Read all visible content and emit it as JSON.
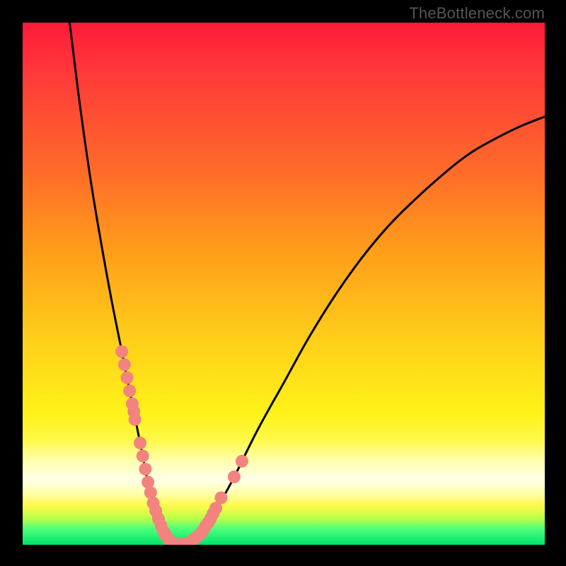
{
  "watermark": "TheBottleneck.com",
  "chart_data": {
    "type": "line",
    "title": "",
    "xlabel": "",
    "ylabel": "",
    "xlim": [
      0,
      100
    ],
    "ylim": [
      0,
      100
    ],
    "grid": false,
    "legend": null,
    "series": [
      {
        "name": "bottleneck-curve",
        "x": [
          9,
          11,
          13,
          15,
          17,
          19,
          20,
          21,
          22,
          23,
          24,
          25,
          26,
          27,
          28,
          29,
          30,
          32,
          34,
          36,
          40,
          45,
          50,
          55,
          60,
          65,
          70,
          75,
          80,
          85,
          90,
          95,
          100
        ],
        "y": [
          100,
          84,
          70,
          58,
          47,
          37,
          32,
          27,
          22,
          17,
          12,
          8,
          5,
          2.5,
          1,
          0.2,
          0,
          0.5,
          2,
          5,
          12,
          22,
          31,
          40,
          48,
          55,
          61,
          66,
          70.5,
          74.5,
          77.5,
          80,
          82
        ]
      }
    ],
    "highlight_points": {
      "name": "threshold-dots",
      "color": "#f2837f",
      "x": [
        19.0,
        19.5,
        20.0,
        20.5,
        21.0,
        21.3,
        21.5,
        22.5,
        23.0,
        23.5,
        24.0,
        24.5,
        25.0,
        25.5,
        26.0,
        26.5,
        27.0,
        27.5,
        28.0,
        28.5,
        29.0,
        29.5,
        30.0,
        30.5,
        31.5,
        32.5,
        33.0,
        33.5,
        34.0,
        34.5,
        35.0,
        35.5,
        36.0,
        36.5,
        37.0,
        38.0,
        40.5,
        42.0
      ],
      "y": [
        37.0,
        34.5,
        32.0,
        29.5,
        27.0,
        25.5,
        24.0,
        19.5,
        17.0,
        14.5,
        12.0,
        10.0,
        8.0,
        6.5,
        5.0,
        3.7,
        2.5,
        1.7,
        1.0,
        0.5,
        0.2,
        0.1,
        0.0,
        0.1,
        0.3,
        0.8,
        1.2,
        1.6,
        2.0,
        2.7,
        3.5,
        4.2,
        5.0,
        6.0,
        7.0,
        9.0,
        13.0,
        16.0
      ]
    },
    "background_gradient": {
      "top": "#ff1a3a",
      "upper_mid": "#ff9e1a",
      "mid": "#fff21a",
      "band_light": "#ffffe8",
      "lower": "#4cff7a",
      "bottom": "#00e26a"
    }
  }
}
